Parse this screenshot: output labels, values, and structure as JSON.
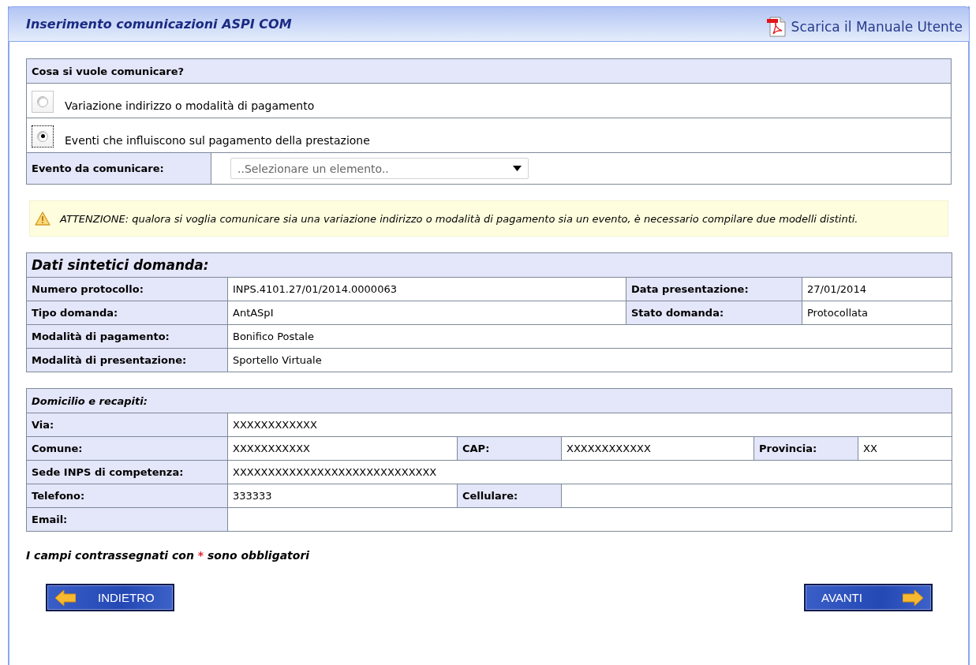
{
  "header": {
    "title": "Inserimento comunicazioni ASPI COM",
    "manual_link": "Scarica il Manuale Utente"
  },
  "choice": {
    "heading": "Cosa si vuole comunicare?",
    "options": [
      {
        "label": "Variazione indirizzo o modalità di pagamento",
        "selected": false
      },
      {
        "label": "Eventi che influiscono sul pagamento della prestazione",
        "selected": true
      }
    ],
    "event_label": "Evento da comunicare:",
    "event_select": {
      "placeholder": "..Selezionare un elemento.."
    }
  },
  "warning": "ATTENZIONE: qualora si voglia comunicare sia una variazione indirizzo o modalità di pagamento sia un evento, è necessario compilare due modelli distinti.",
  "summary": {
    "heading": "Dati sintetici domanda:",
    "rows": [
      [
        {
          "label": "Numero protocollo:",
          "value": "INPS.4101.27/01/2014.0000063"
        },
        {
          "label": "Data presentazione:",
          "value": "27/01/2014"
        }
      ],
      [
        {
          "label": "Tipo domanda:",
          "value": "AntASpI"
        },
        {
          "label": "Stato domanda:",
          "value": "Protocollata"
        }
      ],
      [
        {
          "label": "Modalità di pagamento:",
          "value": "Bonifico Postale"
        }
      ],
      [
        {
          "label": "Modalità di presentazione:",
          "value": "Sportello Virtuale"
        }
      ]
    ]
  },
  "contacts": {
    "heading": "Domicilio e recapiti:",
    "rows": [
      [
        {
          "label": "Via:",
          "value": "XXXXXXXXXXXX"
        }
      ],
      [
        {
          "label": "Comune:",
          "value": "XXXXXXXXXXX"
        },
        {
          "label": "CAP:",
          "value": "XXXXXXXXXXXX"
        },
        {
          "label": "Provincia:",
          "value": "XX"
        }
      ],
      [
        {
          "label": "Sede INPS di competenza:",
          "value": "XXXXXXXXXXXXXXXXXXXXXXXXXXXXX"
        }
      ],
      [
        {
          "label": "Telefono:",
          "value": "333333"
        },
        {
          "label": "Cellulare:"
        }
      ],
      [
        {
          "label": "Email:"
        }
      ]
    ]
  },
  "required_note": {
    "before": "I campi contrassegnati con",
    "mark": "*",
    "after": "sono obbligatori"
  },
  "buttons": [
    {
      "kind": "back",
      "label": "INDIETRO"
    },
    {
      "kind": "next",
      "label": "AVANTI"
    }
  ]
}
